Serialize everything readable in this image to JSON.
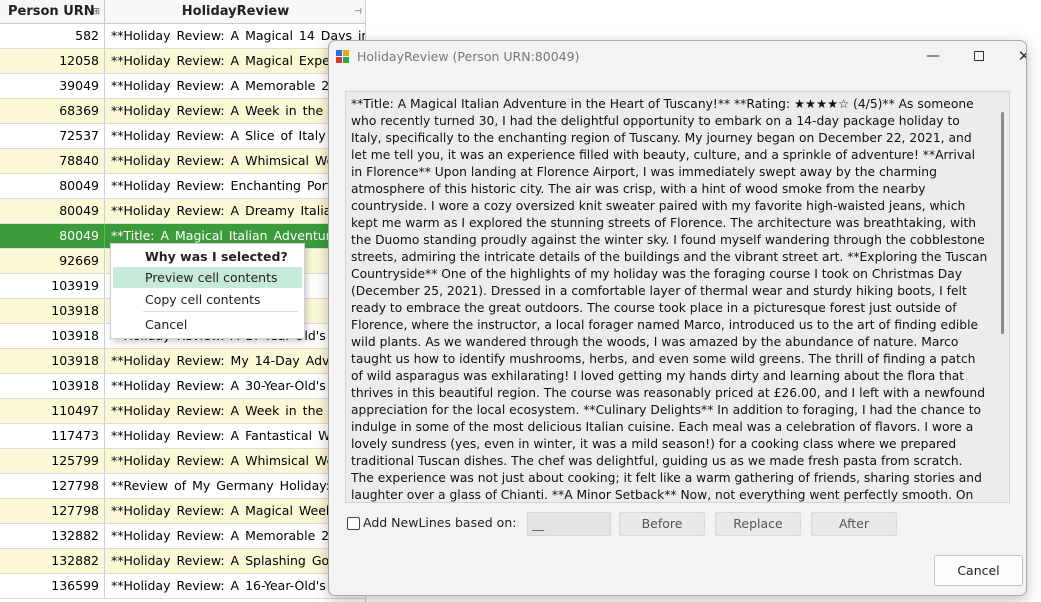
{
  "grid": {
    "columns": {
      "urn": "Person URN",
      "review": "HolidayReview"
    },
    "rows": [
      {
        "urn": "582",
        "review": "**Holiday Review: A Magical 14 Days in...",
        "alt": false,
        "selected": false
      },
      {
        "urn": "12058",
        "review": "**Holiday Review: A Magical Experie",
        "alt": true,
        "selected": false
      },
      {
        "urn": "39049",
        "review": "**Holiday Review: A Memorable 21",
        "alt": false,
        "selected": false
      },
      {
        "urn": "68369",
        "review": "**Holiday Review: A Week in the En",
        "alt": true,
        "selected": false
      },
      {
        "urn": "72537",
        "review": "**Holiday Review: A Slice of Italy fro",
        "alt": false,
        "selected": false
      },
      {
        "urn": "78840",
        "review": "**Holiday Review: A Whimsical Week",
        "alt": true,
        "selected": false
      },
      {
        "urn": "80049",
        "review": "**Holiday Review: Enchanting Portu",
        "alt": false,
        "selected": false
      },
      {
        "urn": "80049",
        "review": "**Holiday Review: A Dreamy Italian E",
        "alt": true,
        "selected": false
      },
      {
        "urn": "80049",
        "review": "**Title: A Magical Italian Adventure",
        "alt": false,
        "selected": true
      },
      {
        "urn": "92669",
        "review": "**Holiday Review: A Fam",
        "alt": true,
        "selected": false
      },
      {
        "urn": "103919",
        "review": "**Holiday Review: A Fam",
        "alt": false,
        "selected": false
      },
      {
        "urn": "103918",
        "review": "**Holiday Review: A Adve",
        "alt": true,
        "selected": false
      },
      {
        "urn": "103918",
        "review": "**Holiday Review: A 17-Year-Old's Adv",
        "alt": false,
        "selected": false
      },
      {
        "urn": "103918",
        "review": "**Holiday Review: My 14-Day Adver",
        "alt": true,
        "selected": false
      },
      {
        "urn": "103918",
        "review": "**Holiday Review: A 30-Year-Old's Adv",
        "alt": false,
        "selected": false
      },
      {
        "urn": "110497",
        "review": "**Holiday Review: A Week in the He",
        "alt": true,
        "selected": false
      },
      {
        "urn": "117473",
        "review": "**Holiday Review: A Fantastical Wee",
        "alt": false,
        "selected": false
      },
      {
        "urn": "125799",
        "review": "**Holiday Review: A Whimsical Week",
        "alt": true,
        "selected": false
      },
      {
        "urn": "127798",
        "review": "**Review of My Germany Holiday: A",
        "alt": false,
        "selected": false
      },
      {
        "urn": "127798",
        "review": "**Holiday Review: A Magical Week in",
        "alt": true,
        "selected": false
      },
      {
        "urn": "132882",
        "review": "**Holiday Review: A Memorable 21",
        "alt": false,
        "selected": false
      },
      {
        "urn": "132882",
        "review": "**Holiday Review: A Splashing Good",
        "alt": true,
        "selected": false
      },
      {
        "urn": "136599",
        "review": "**Holiday Review: A 16-Year-Old's A",
        "alt": false,
        "selected": false
      }
    ]
  },
  "context_menu": {
    "title": "Why was I selected?",
    "preview": "Preview cell contents",
    "copy": "Copy cell contents",
    "cancel": "Cancel"
  },
  "dialog": {
    "title": "HolidayReview (Person URN:80049)",
    "text": "**Title: A Magical Italian Adventure in the Heart of Tuscany!** **Rating: ★★★★☆ (4/5)** As someone who recently turned 30, I had the delightful opportunity to embark on a 14-day package holiday to Italy, specifically to the enchanting region of Tuscany. My journey began on December 22, 2021, and let me tell you, it was an experience filled with beauty, culture, and a sprinkle of adventure! **Arrival in Florence** Upon landing at Florence Airport, I was immediately swept away by the charming atmosphere of this historic city. The air was crisp, with a hint of wood smoke from the nearby countryside. I wore a cozy oversized knit sweater paired with my favorite high-waisted jeans, which kept me warm as I explored the stunning streets of Florence. The architecture was breathtaking, with the Duomo standing proudly against the winter sky. I found myself wandering through the cobblestone streets, admiring the intricate details of the buildings and the vibrant street art. **Exploring the Tuscan Countryside** One of the highlights of my holiday was the foraging course I took on Christmas Day (December 25, 2021). Dressed in a comfortable layer of thermal wear and sturdy hiking boots, I felt ready to embrace the great outdoors. The course took place in a picturesque forest just outside of Florence, where the instructor, a local forager named Marco, introduced us to the art of finding edible wild plants. As we wandered through the woods, I was amazed by the abundance of nature. Marco taught us how to identify mushrooms, herbs, and even some wild greens. The thrill of finding a patch of wild asparagus was exhilarating! I loved getting my hands dirty and learning about the flora that thrives in this beautiful region. The course was reasonably priced at £26.00, and I left with a newfound appreciation for the local ecosystem. **Culinary Delights** In addition to foraging, I had the chance to indulge in some of the most delicious Italian cuisine. Each meal was a celebration of flavors. I wore a lovely sundress (yes, even in winter, it was a mild season!) for a cooking class where we prepared traditional Tuscan dishes. The chef was delightful, guiding us as we made fresh pasta from scratch. The experience was not just about cooking; it felt like a warm gathering of friends, sharing stories and laughter over a glass of Chianti. **A Minor Setback** Now, not everything went perfectly smooth. On my second day, while I was out exploring the Uffizi Gallery, I accidentally spilled some of my delicious gelato on my sundress. It was a minor mishap, but it did leave a",
    "newlines_label": "Add NewLines based on:",
    "newlines_value": "__",
    "before": "Before",
    "replace": "Replace",
    "after": "After",
    "cancel": "Cancel",
    "window_controls": {
      "minimize": "—",
      "maximize": "",
      "close": "✕"
    }
  },
  "colors": {
    "selected_row": "#3b9b3b",
    "alt_row": "#fbf8d6",
    "menu_highlight": "#c7ead8"
  }
}
